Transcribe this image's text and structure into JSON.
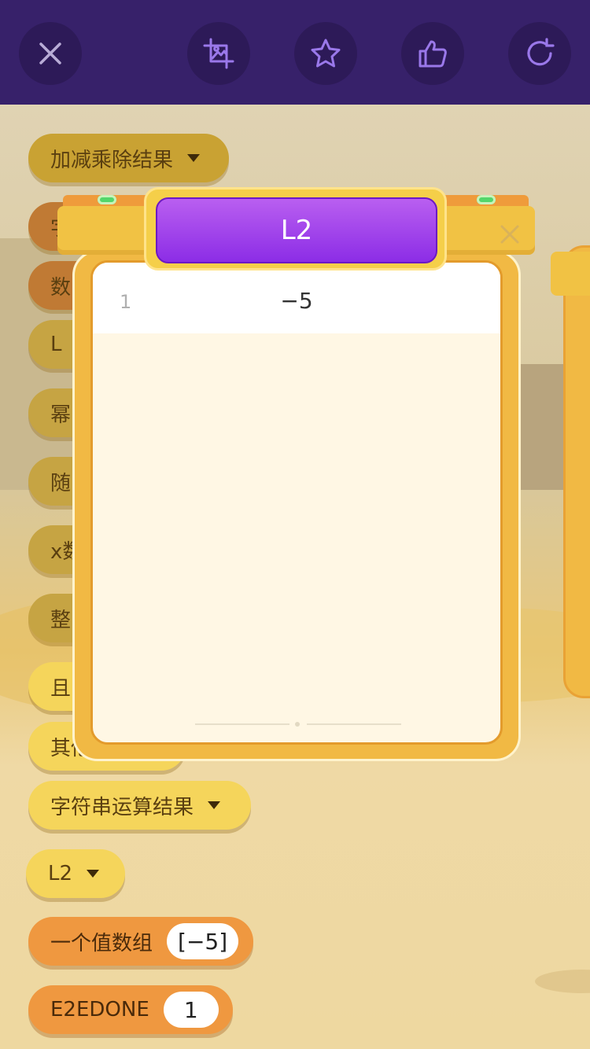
{
  "toolbar": {
    "close_icon": "close-icon",
    "screenshot_icon": "crop-image-icon",
    "favorite_icon": "star-icon",
    "like_icon": "thumbs-up-icon",
    "refresh_icon": "refresh-icon"
  },
  "blocks": [
    {
      "label": "加减乘除结果"
    },
    {
      "label": "字"
    },
    {
      "label": "数"
    },
    {
      "label": "L"
    },
    {
      "label": "幂"
    },
    {
      "label": "随"
    },
    {
      "label": "x数"
    },
    {
      "label": "整"
    },
    {
      "label": "且"
    },
    {
      "label": "其他"
    },
    {
      "label": "字符串运算结果"
    },
    {
      "label": "L2"
    },
    {
      "label": "一个值数组",
      "value": "[−5]"
    },
    {
      "label": "E2EDONE",
      "value": "1"
    }
  ],
  "modal": {
    "title": "L2",
    "rows": [
      {
        "index": "1",
        "value": "−5"
      }
    ]
  },
  "colors": {
    "topbar": "#37216a",
    "title_pill": "#9b3deb",
    "panel": "#f1b944",
    "block_yellow": "#f5d55b",
    "block_orange": "#ef9840"
  }
}
